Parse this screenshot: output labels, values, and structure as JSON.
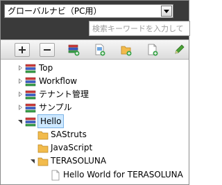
{
  "nav": {
    "select_value": "グローバルナビ（PC用）"
  },
  "search": {
    "placeholder": "検索キーワードを入力して"
  },
  "toolbar": {
    "buttons": [
      {
        "name": "expand-all-button",
        "icon": "plus-icon"
      },
      {
        "name": "collapse-all-button",
        "icon": "minus-icon"
      },
      {
        "name": "add-menu-button",
        "icon": "menu-add-icon"
      },
      {
        "name": "add-page-button",
        "icon": "page-add-icon"
      },
      {
        "name": "add-folder-button",
        "icon": "folder-add-icon"
      },
      {
        "name": "new-document-button",
        "icon": "document-add-icon"
      },
      {
        "name": "edit-button",
        "icon": "pencil-icon"
      }
    ]
  },
  "tree": {
    "top": {
      "label": "Top"
    },
    "workflow": {
      "label": "Workflow"
    },
    "tenant": {
      "label": "テナント管理"
    },
    "sample": {
      "label": "サンプル"
    },
    "hello": {
      "label": "Hello"
    },
    "sastruts": {
      "label": "SAStruts"
    },
    "javascript": {
      "label": "JavaScript"
    },
    "terasoluna": {
      "label": "TERASOLUNA"
    },
    "hello_world": {
      "label": "Hello World for TERASOLUNA"
    }
  },
  "colors": {
    "header_bg": "#3a3a3a",
    "selection_bg": "#cde8ff",
    "folder": "#f2bb4c",
    "menu_icon_red": "#d23b3b",
    "menu_icon_blue": "#3a5fcd",
    "menu_icon_green": "#3aa34a"
  }
}
